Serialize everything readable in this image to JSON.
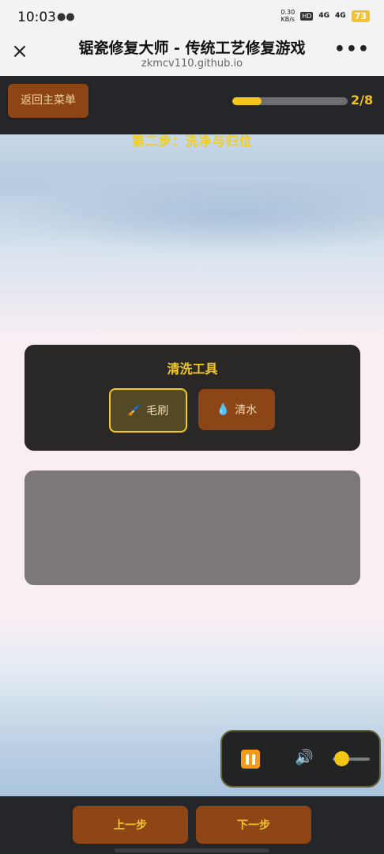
{
  "status_bar": {
    "time": "10:03",
    "wechat_icon": "wechat-icon",
    "net_speed_value": "0.30",
    "net_speed_unit": "KB/s",
    "hd_label": "HD",
    "hd_sub": "1 2",
    "signal1": "4G",
    "signal2": "4G",
    "battery": "73"
  },
  "browser": {
    "close_icon": "×",
    "title": "锯瓷修复大师 - 传统工艺修复游戏",
    "url": "zkmcv110.github.io",
    "more_icon": "•••"
  },
  "game": {
    "back_label": "返回主菜单",
    "progress_fraction": 0.25,
    "progress_text": "2/8",
    "step_title": "第二步：洗净与归位",
    "tools": {
      "title": "清洗工具",
      "brush_icon": "🖌️",
      "brush_label": "毛刷",
      "water_icon": "💧",
      "water_label": "清水"
    },
    "audio": {
      "pause_icon": "pause-icon",
      "speaker_icon": "🔊",
      "volume_level": 0.25
    },
    "nav": {
      "prev_label": "上一步",
      "next_label": "下一步"
    }
  },
  "colors": {
    "accent_gold": "#f2c820",
    "button_brown": "#8e4516",
    "dark_bar": "#25262a"
  }
}
